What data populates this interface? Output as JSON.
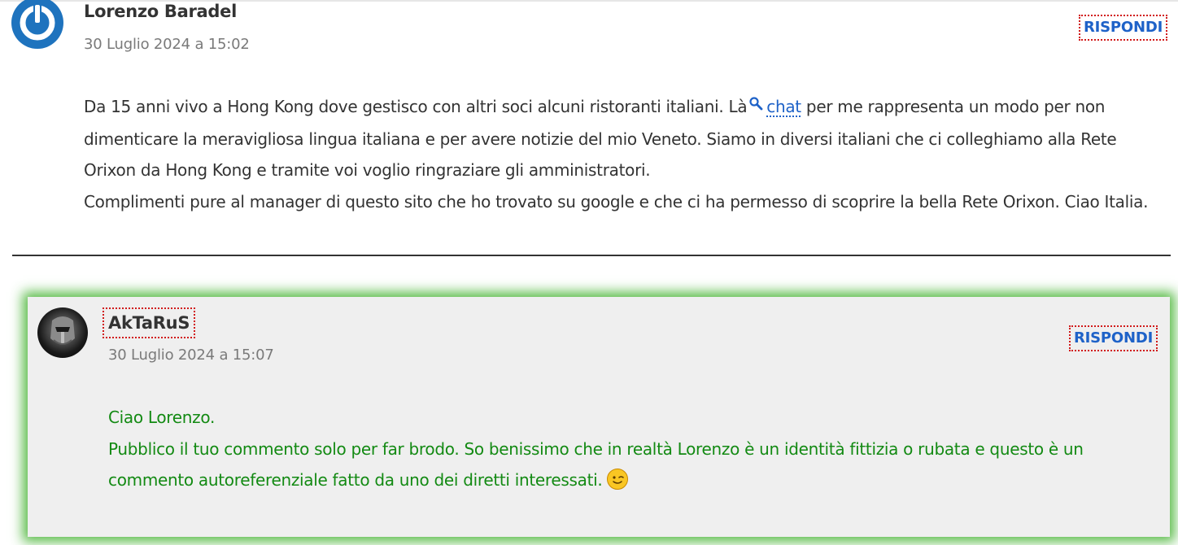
{
  "comments": [
    {
      "author": "Lorenzo Baradel",
      "date": "30 Luglio 2024 a 15:02",
      "reply_label": "RISPONDI",
      "body": {
        "line1_before_link": "Da 15 anni vivo a Hong Kong dove gestisco con altri soci alcuni ristoranti italiani. Là",
        "link_text": "chat",
        "line1_after_link": "per me rappresenta un modo per non",
        "line2": "dimenticare la meravigliosa lingua italiana e per avere notizie del mio Veneto. Siamo in diversi italiani che ci colleghiamo alla Rete",
        "line3": "Orixon da Hong Kong e tramite voi voglio ringraziare gli amministratori.",
        "line4": "Complimenti pure al manager di questo sito che ho trovato su google e che ci ha permesso di scoprire la bella Rete Orixon. Ciao Italia."
      },
      "icons": {
        "avatar": "power-avatar-icon",
        "link_icon": "search-icon"
      },
      "colors": {
        "avatar": "#1e73be",
        "link": "#1e62c8"
      }
    },
    {
      "author": "AkTaRuS",
      "date": "30 Luglio 2024 a 15:07",
      "reply_label": "RISPONDI",
      "body": {
        "line1": "Ciao Lorenzo.",
        "line2": "Pubblico il tuo commento solo per far brodo. So benissimo che in realtà Lorenzo è un identità fittizia o rubata e questo è un",
        "line3": "commento autoreferenziale fatto da uno dei diretti interessati."
      },
      "icons": {
        "avatar": "helmet-avatar-icon",
        "emoji": "wink-emoji-icon"
      },
      "colors": {
        "text": "#138a13",
        "highlight_glow": "#3caf28",
        "background": "#efefef"
      }
    }
  ]
}
